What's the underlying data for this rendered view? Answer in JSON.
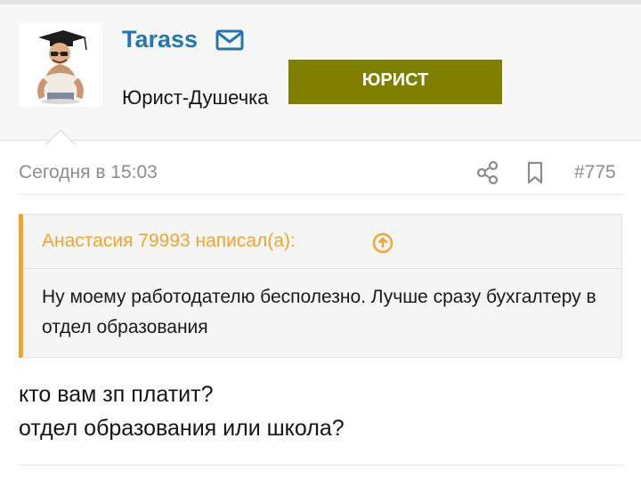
{
  "user": {
    "name": "Tarass",
    "title": "Юрист-Душечка",
    "banner": "Юрист",
    "banner_color": "#808000",
    "name_color": "#2577b1",
    "icons": {
      "mail": "envelope-icon"
    }
  },
  "post": {
    "date": "Сегодня в 15:03",
    "number": "#775",
    "icons": {
      "share": "share-icon",
      "bookmark": "bookmark-icon"
    },
    "quote": {
      "author_line": "Анастасия 79993 написал(а):",
      "text": "Ну моему работодателю бесполезно. Лучше сразу бухгалтеру в отдел образования",
      "accent_color": "#f4a428",
      "icon": "arrow-up-circle-icon"
    },
    "message_lines": [
      "кто вам зп платит?",
      "отдел образования или школа?"
    ]
  }
}
